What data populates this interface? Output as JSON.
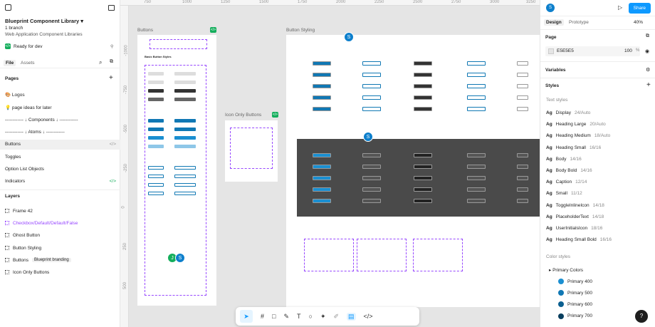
{
  "file": {
    "title": "Blueprint Component Library",
    "branch": "1 branch",
    "subtitle": "Web Application Component Libraries",
    "status": "Ready for dev"
  },
  "left_tabs": [
    "File",
    "Assets"
  ],
  "pages_header": "Pages",
  "pages": [
    "🎨 Logos",
    "💡 page ideas for later",
    "------------ ↓ Components ↓ ------------",
    "------------ ↓ Atoms ↓ ------------",
    "Buttons",
    "Toggles",
    "Option List Objects",
    "Indicators"
  ],
  "layers_header": "Layers",
  "layers": [
    {
      "label": "Frame 42",
      "chip": ""
    },
    {
      "label": "Checkbox/Default/Default/False",
      "chip": ""
    },
    {
      "label": "Ghost Button",
      "chip": ""
    },
    {
      "label": "Button Styling",
      "chip": ""
    },
    {
      "label": "Buttons",
      "chip": "Blueprint branding"
    },
    {
      "label": "Icon Only Buttons",
      "chip": ""
    }
  ],
  "ruler_top": [
    "750",
    "1000",
    "1250",
    "1500",
    "1750",
    "2000",
    "2250",
    "2500",
    "2750",
    "3000",
    "3250"
  ],
  "ruler_left": [
    "-1000",
    "-750",
    "-500",
    "-250",
    "0",
    "250",
    "500"
  ],
  "canvas": {
    "frame_buttons": "Buttons",
    "frame_icon_only": "Icon Only Buttons",
    "frame_styling": "Button Styling",
    "basic_styles": "Basic Button Styles",
    "cursor_labels": [
      "S",
      "S",
      "J",
      "S"
    ]
  },
  "toolbar": {
    "icons": [
      "move-icon",
      "frame-icon",
      "shape-icon",
      "pen-icon",
      "text-icon",
      "comment-icon",
      "actions-icon",
      "draw-icon",
      "dev-mode-icon",
      "code-icon"
    ]
  },
  "right": {
    "user": "S",
    "share": "Share",
    "tabs": [
      "Design",
      "Prototype"
    ],
    "zoom": "40%",
    "page_header": "Page",
    "page_color": "E5E5E5",
    "page_opacity": "100",
    "page_pct": "%",
    "variables": "Variables",
    "styles": "Styles",
    "text_styles_header": "Text styles",
    "text_styles": [
      {
        "name": "Display",
        "size": "24/Auto"
      },
      {
        "name": "Heading Large",
        "size": "20/Auto"
      },
      {
        "name": "Heading Medium",
        "size": "18/Auto"
      },
      {
        "name": "Heading Small",
        "size": "16/16"
      },
      {
        "name": "Body",
        "size": "14/16"
      },
      {
        "name": "Body Bold",
        "size": "14/16"
      },
      {
        "name": "Caption",
        "size": "12/14"
      },
      {
        "name": "Small",
        "size": "11/12"
      },
      {
        "name": "ToggleInlineIcon",
        "size": "14/18"
      },
      {
        "name": "PlaceholderText",
        "size": "14/18"
      },
      {
        "name": "UserInitialsIcon",
        "size": "18/16"
      },
      {
        "name": "Heading Small Bold",
        "size": "16/16"
      }
    ],
    "color_styles_header": "Color styles",
    "color_group": "Primary Colors",
    "colors": [
      {
        "name": "Primary 400",
        "hex": "#1b8fd1"
      },
      {
        "name": "Primary 500",
        "hex": "#1078b4"
      },
      {
        "name": "Primary 600",
        "hex": "#0b5f90"
      },
      {
        "name": "Primary 700",
        "hex": "#083e5e"
      }
    ],
    "help": "?"
  },
  "colors": {
    "accent": "#0d99ff",
    "purple": "#9747ff",
    "green": "#14ae5c"
  }
}
